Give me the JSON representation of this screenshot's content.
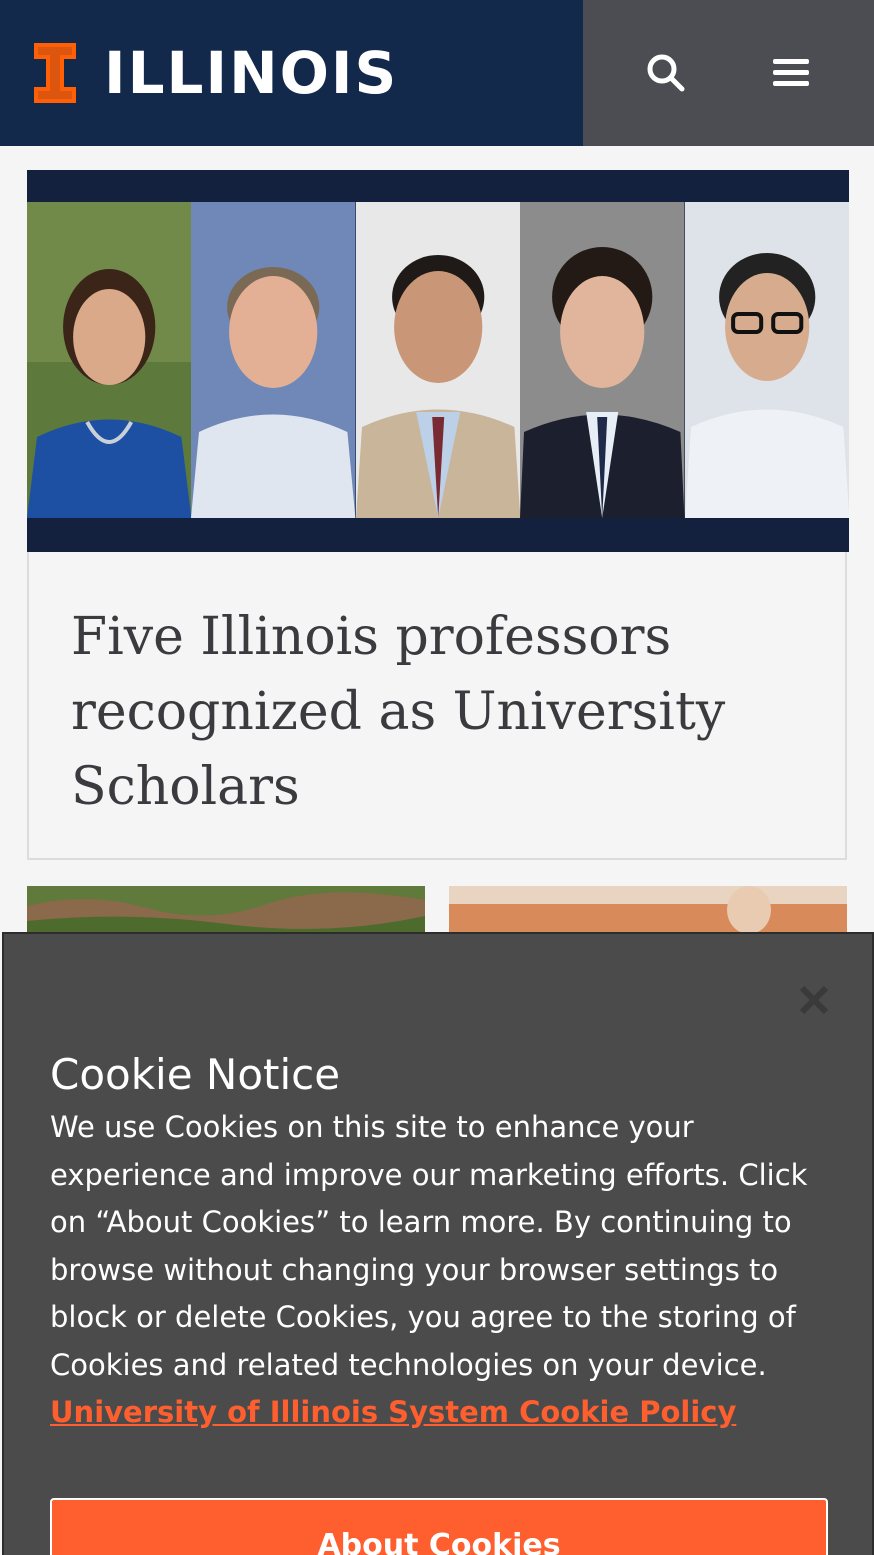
{
  "header": {
    "logo_text": "ILLINOIS",
    "search_icon": "search-icon",
    "menu_icon": "hamburger-menu-icon",
    "colors": {
      "brand_bg": "#13294b",
      "actions_bg": "#4b4d52",
      "orange": "#ff5f05"
    }
  },
  "feature": {
    "headline_lines": [
      "Five Illinois professors",
      "recognized as University",
      "Scholars"
    ],
    "image_alt": "Portraits of five professors"
  },
  "cookie_notice": {
    "title": "Cookie Notice",
    "body": "We use Cookies on this site to enhance your experience and improve our marketing efforts. Click on “About Cookies” to learn more. By continuing to browse without changing your browser settings to block or delete Cookies, you agree to the storing of Cookies and related technologies on your device.",
    "link_text": "University of Illinois System Cookie Policy",
    "button_label": "About Cookies",
    "close_icon": "close-icon",
    "colors": {
      "bg": "#4b4b4b",
      "accent": "#ff5f2e"
    }
  }
}
